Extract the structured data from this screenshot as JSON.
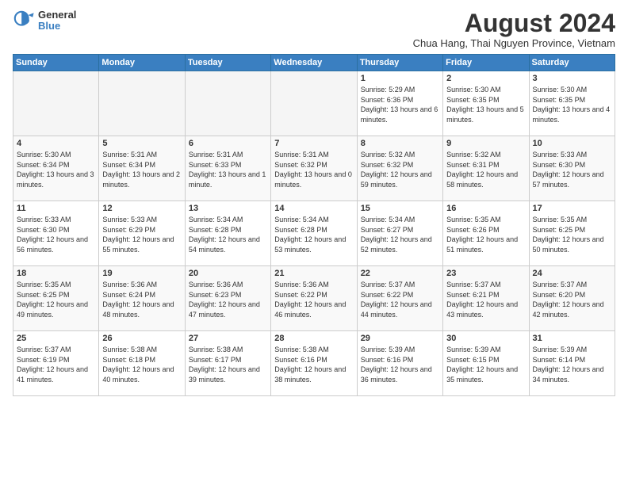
{
  "logo": {
    "general": "General",
    "blue": "Blue"
  },
  "title": "August 2024",
  "location": "Chua Hang, Thai Nguyen Province, Vietnam",
  "days_of_week": [
    "Sunday",
    "Monday",
    "Tuesday",
    "Wednesday",
    "Thursday",
    "Friday",
    "Saturday"
  ],
  "weeks": [
    [
      {
        "day": "",
        "empty": true
      },
      {
        "day": "",
        "empty": true
      },
      {
        "day": "",
        "empty": true
      },
      {
        "day": "",
        "empty": true
      },
      {
        "day": "1",
        "sunrise": "5:29 AM",
        "sunset": "6:36 PM",
        "daylight": "13 hours and 6 minutes."
      },
      {
        "day": "2",
        "sunrise": "5:30 AM",
        "sunset": "6:35 PM",
        "daylight": "13 hours and 5 minutes."
      },
      {
        "day": "3",
        "sunrise": "5:30 AM",
        "sunset": "6:35 PM",
        "daylight": "13 hours and 4 minutes."
      }
    ],
    [
      {
        "day": "4",
        "sunrise": "5:30 AM",
        "sunset": "6:34 PM",
        "daylight": "13 hours and 3 minutes."
      },
      {
        "day": "5",
        "sunrise": "5:31 AM",
        "sunset": "6:34 PM",
        "daylight": "13 hours and 2 minutes."
      },
      {
        "day": "6",
        "sunrise": "5:31 AM",
        "sunset": "6:33 PM",
        "daylight": "13 hours and 1 minute."
      },
      {
        "day": "7",
        "sunrise": "5:31 AM",
        "sunset": "6:32 PM",
        "daylight": "13 hours and 0 minutes."
      },
      {
        "day": "8",
        "sunrise": "5:32 AM",
        "sunset": "6:32 PM",
        "daylight": "12 hours and 59 minutes."
      },
      {
        "day": "9",
        "sunrise": "5:32 AM",
        "sunset": "6:31 PM",
        "daylight": "12 hours and 58 minutes."
      },
      {
        "day": "10",
        "sunrise": "5:33 AM",
        "sunset": "6:30 PM",
        "daylight": "12 hours and 57 minutes."
      }
    ],
    [
      {
        "day": "11",
        "sunrise": "5:33 AM",
        "sunset": "6:30 PM",
        "daylight": "12 hours and 56 minutes."
      },
      {
        "day": "12",
        "sunrise": "5:33 AM",
        "sunset": "6:29 PM",
        "daylight": "12 hours and 55 minutes."
      },
      {
        "day": "13",
        "sunrise": "5:34 AM",
        "sunset": "6:28 PM",
        "daylight": "12 hours and 54 minutes."
      },
      {
        "day": "14",
        "sunrise": "5:34 AM",
        "sunset": "6:28 PM",
        "daylight": "12 hours and 53 minutes."
      },
      {
        "day": "15",
        "sunrise": "5:34 AM",
        "sunset": "6:27 PM",
        "daylight": "12 hours and 52 minutes."
      },
      {
        "day": "16",
        "sunrise": "5:35 AM",
        "sunset": "6:26 PM",
        "daylight": "12 hours and 51 minutes."
      },
      {
        "day": "17",
        "sunrise": "5:35 AM",
        "sunset": "6:25 PM",
        "daylight": "12 hours and 50 minutes."
      }
    ],
    [
      {
        "day": "18",
        "sunrise": "5:35 AM",
        "sunset": "6:25 PM",
        "daylight": "12 hours and 49 minutes."
      },
      {
        "day": "19",
        "sunrise": "5:36 AM",
        "sunset": "6:24 PM",
        "daylight": "12 hours and 48 minutes."
      },
      {
        "day": "20",
        "sunrise": "5:36 AM",
        "sunset": "6:23 PM",
        "daylight": "12 hours and 47 minutes."
      },
      {
        "day": "21",
        "sunrise": "5:36 AM",
        "sunset": "6:22 PM",
        "daylight": "12 hours and 46 minutes."
      },
      {
        "day": "22",
        "sunrise": "5:37 AM",
        "sunset": "6:22 PM",
        "daylight": "12 hours and 44 minutes."
      },
      {
        "day": "23",
        "sunrise": "5:37 AM",
        "sunset": "6:21 PM",
        "daylight": "12 hours and 43 minutes."
      },
      {
        "day": "24",
        "sunrise": "5:37 AM",
        "sunset": "6:20 PM",
        "daylight": "12 hours and 42 minutes."
      }
    ],
    [
      {
        "day": "25",
        "sunrise": "5:37 AM",
        "sunset": "6:19 PM",
        "daylight": "12 hours and 41 minutes."
      },
      {
        "day": "26",
        "sunrise": "5:38 AM",
        "sunset": "6:18 PM",
        "daylight": "12 hours and 40 minutes."
      },
      {
        "day": "27",
        "sunrise": "5:38 AM",
        "sunset": "6:17 PM",
        "daylight": "12 hours and 39 minutes."
      },
      {
        "day": "28",
        "sunrise": "5:38 AM",
        "sunset": "6:16 PM",
        "daylight": "12 hours and 38 minutes."
      },
      {
        "day": "29",
        "sunrise": "5:39 AM",
        "sunset": "6:16 PM",
        "daylight": "12 hours and 36 minutes."
      },
      {
        "day": "30",
        "sunrise": "5:39 AM",
        "sunset": "6:15 PM",
        "daylight": "12 hours and 35 minutes."
      },
      {
        "day": "31",
        "sunrise": "5:39 AM",
        "sunset": "6:14 PM",
        "daylight": "12 hours and 34 minutes."
      }
    ]
  ]
}
